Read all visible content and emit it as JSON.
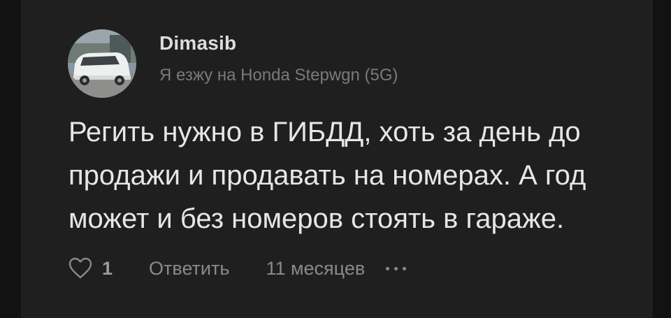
{
  "comment": {
    "author": "Dimasib",
    "car": "Я езжу на Honda Stepwgn (5G)",
    "text": "Регить нужно в ГИБДД, хоть за день до продажи и продавать на номерах. А год может и без номеров стоять в гараже.",
    "likes": "1",
    "reply_label": "Ответить",
    "timestamp": "11 месяцев",
    "avatar": "avatar-photo-white-minivan",
    "like_icon": "heart-outline-icon",
    "more_icon": "ellipsis-icon"
  },
  "colors": {
    "background": "#121212",
    "card": "#1f1f1f",
    "text": "#e6e6e6",
    "muted": "#7a7a7a"
  }
}
